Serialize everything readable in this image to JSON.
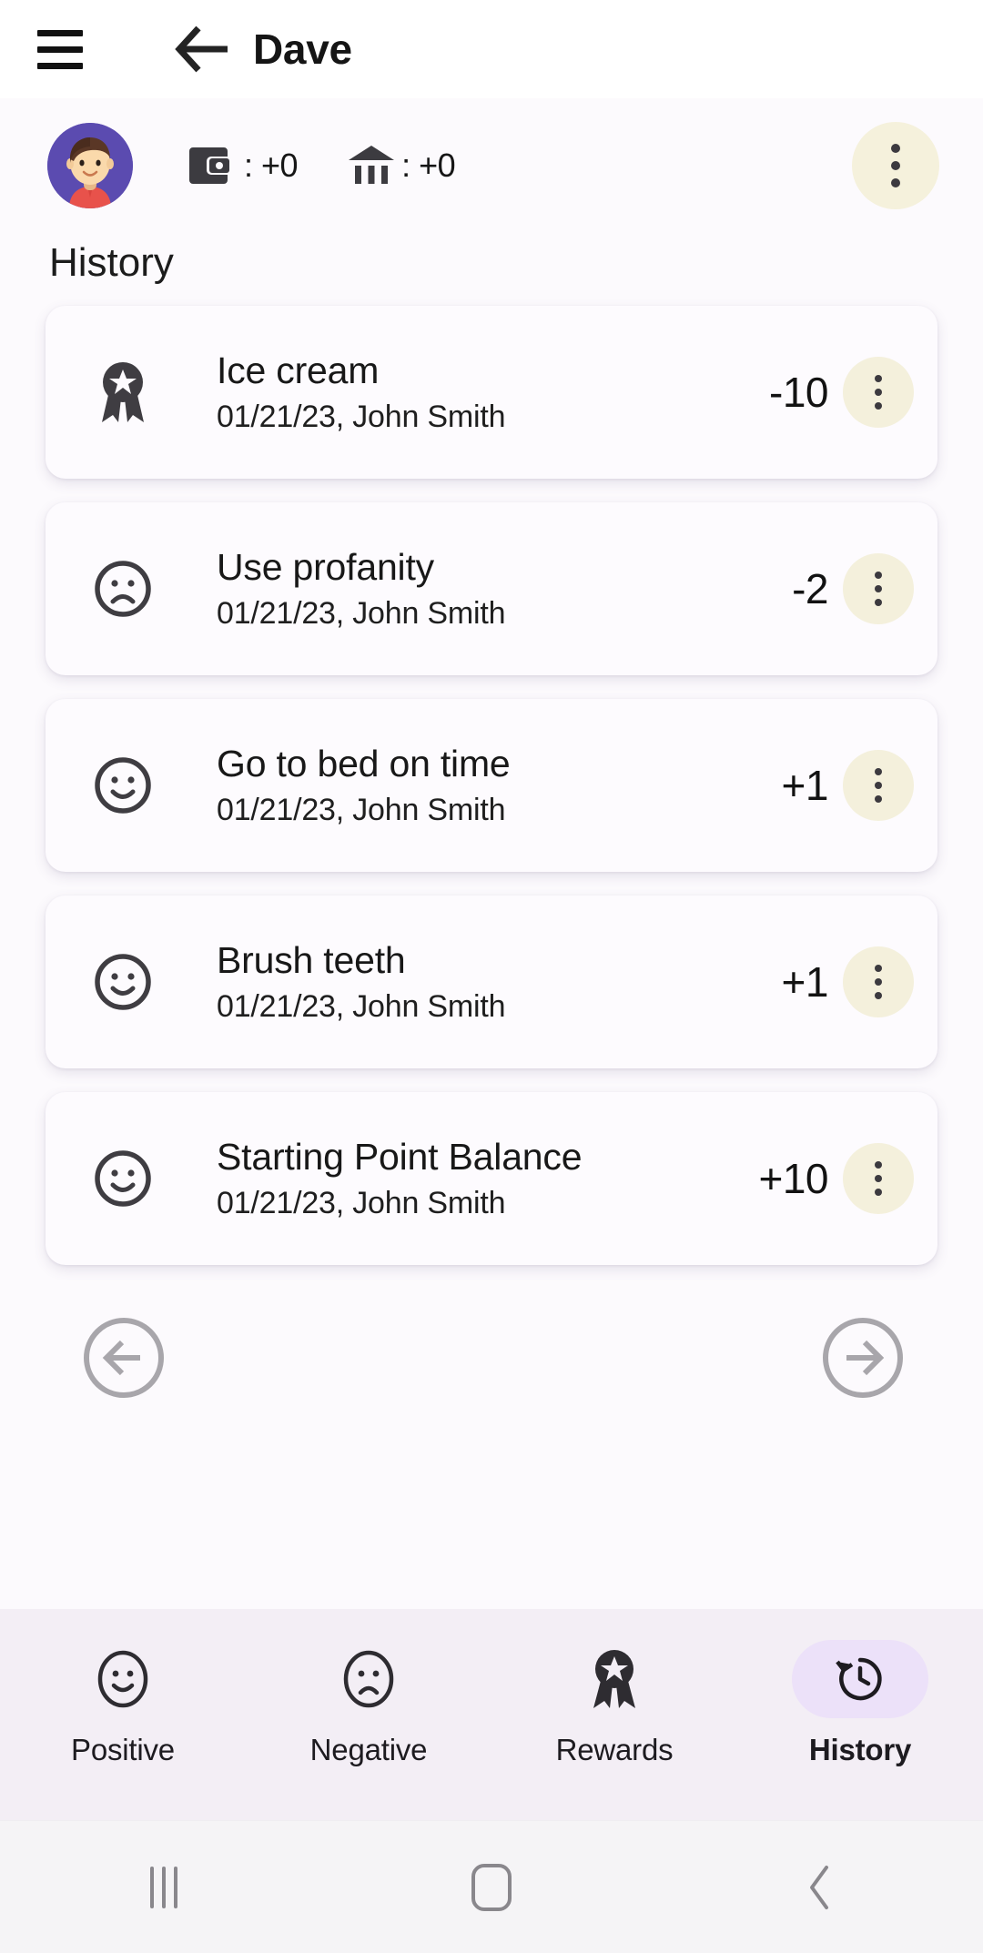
{
  "appbar": {
    "menu_icon": "hamburger-menu-icon",
    "back_icon": "back-arrow-icon",
    "title": "Dave"
  },
  "profile": {
    "avatar_icon": "boy-avatar",
    "avatar_bg": "#5b4bb0",
    "balances": [
      {
        "icon": "wallet-icon",
        "value": ": +0"
      },
      {
        "icon": "bank-icon",
        "value": ": +0"
      }
    ],
    "overflow_icon": "more-vertical-icon",
    "overflow_bg": "#f5f1dc"
  },
  "section": {
    "title": "History"
  },
  "history": {
    "items": [
      {
        "icon": "ribbon-award-icon",
        "title": "Ice cream",
        "subtitle": "01/21/23, John Smith",
        "score": "-10",
        "menu_icon": "more-vertical-icon"
      },
      {
        "icon": "frowning-face-icon",
        "title": "Use profanity",
        "subtitle": "01/21/23, John Smith",
        "score": "-2",
        "menu_icon": "more-vertical-icon"
      },
      {
        "icon": "smiling-face-icon",
        "title": "Go to bed on time",
        "subtitle": "01/21/23, John Smith",
        "score": "+1",
        "menu_icon": "more-vertical-icon"
      },
      {
        "icon": "smiling-face-icon",
        "title": "Brush teeth",
        "subtitle": "01/21/23, John Smith",
        "score": "+1",
        "menu_icon": "more-vertical-icon"
      },
      {
        "icon": "smiling-face-icon",
        "title": "Starting Point Balance",
        "subtitle": "01/21/23, John Smith",
        "score": "+10",
        "menu_icon": "more-vertical-icon"
      }
    ]
  },
  "pager": {
    "prev_icon": "circle-arrow-left-icon",
    "next_icon": "circle-arrow-right-icon",
    "color": "#a8a6ab"
  },
  "tabbar": {
    "active_index": 3,
    "active_pill_color": "#ece1f9",
    "tabs": [
      {
        "icon": "smiling-face-icon",
        "label": "Positive"
      },
      {
        "icon": "frowning-face-icon",
        "label": "Negative"
      },
      {
        "icon": "ribbon-award-icon",
        "label": "Rewards"
      },
      {
        "icon": "history-clock-icon",
        "label": "History"
      }
    ]
  },
  "sysnav": {
    "recents_icon": "recents-icon",
    "home_icon": "home-icon",
    "back_icon": "system-back-icon"
  }
}
